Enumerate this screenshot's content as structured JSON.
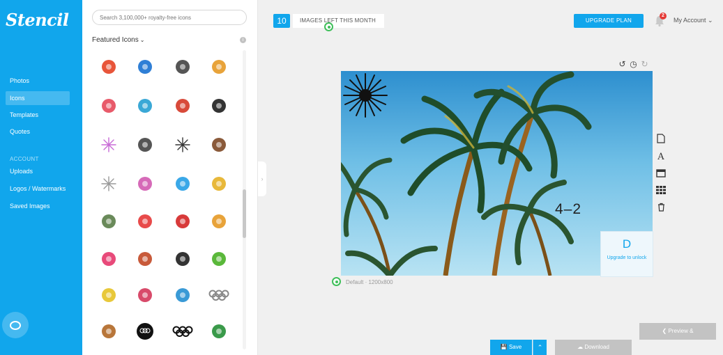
{
  "sidebar": {
    "logo": "Stencil",
    "items": [
      {
        "label": "Photos",
        "active": false
      },
      {
        "label": "Icons",
        "active": true
      },
      {
        "label": "Templates",
        "active": false
      },
      {
        "label": "Quotes",
        "active": false
      }
    ],
    "section_label": "ACCOUNT",
    "account_items": [
      {
        "label": "Uploads"
      },
      {
        "label": "Logos / Watermarks"
      },
      {
        "label": "Saved Images"
      }
    ]
  },
  "panel": {
    "search_placeholder": "Search 3,100,000+ royalty-free icons",
    "featured_label": "Featured Icons",
    "icons": [
      "magnifier-icon",
      "utensils-icon",
      "notebook-icon",
      "castle-icon",
      "watermelon-slice-icon",
      "beach-hut-icon",
      "backpack-icon",
      "camera-lens-icon",
      "sparkler-icon",
      "sea-urchin-icon",
      "palm-burst-icon",
      "drink-cup-icon",
      "starburst-icon",
      "popsicle-icon",
      "waves-flag-icon",
      "sun-glasses-icon",
      "grass-cup-icon",
      "watermelon-wedge-icon",
      "strawberry-icon",
      "mango-icon",
      "flower-icon",
      "woman-icon",
      "tulip-icon",
      "farm-scene-icon",
      "sprout-icon",
      "cherry-branch-icon",
      "easter-egg-icon",
      "olympic-rings-outline-icon",
      "medal-icon",
      "olympic-badge-icon",
      "olympic-rings-icon",
      "leprechaun-icon"
    ]
  },
  "header": {
    "count": "10",
    "count_label": "IMAGES LEFT THIS MONTH",
    "upgrade_label": "UPGRADE PLAN",
    "notification_count": "2",
    "account_label": "My Account"
  },
  "canvas": {
    "overlay_text": "4–2",
    "size_label": "Default · 1200x800",
    "upgrade_card_letter": "D",
    "upgrade_card_text": "Upgrade to unlock"
  },
  "footer": {
    "preview_label": "Preview &",
    "save_label": "Save",
    "download_label": "Download"
  },
  "colors": {
    "brand": "#11a6ec",
    "handle": "#3fbf5a"
  }
}
